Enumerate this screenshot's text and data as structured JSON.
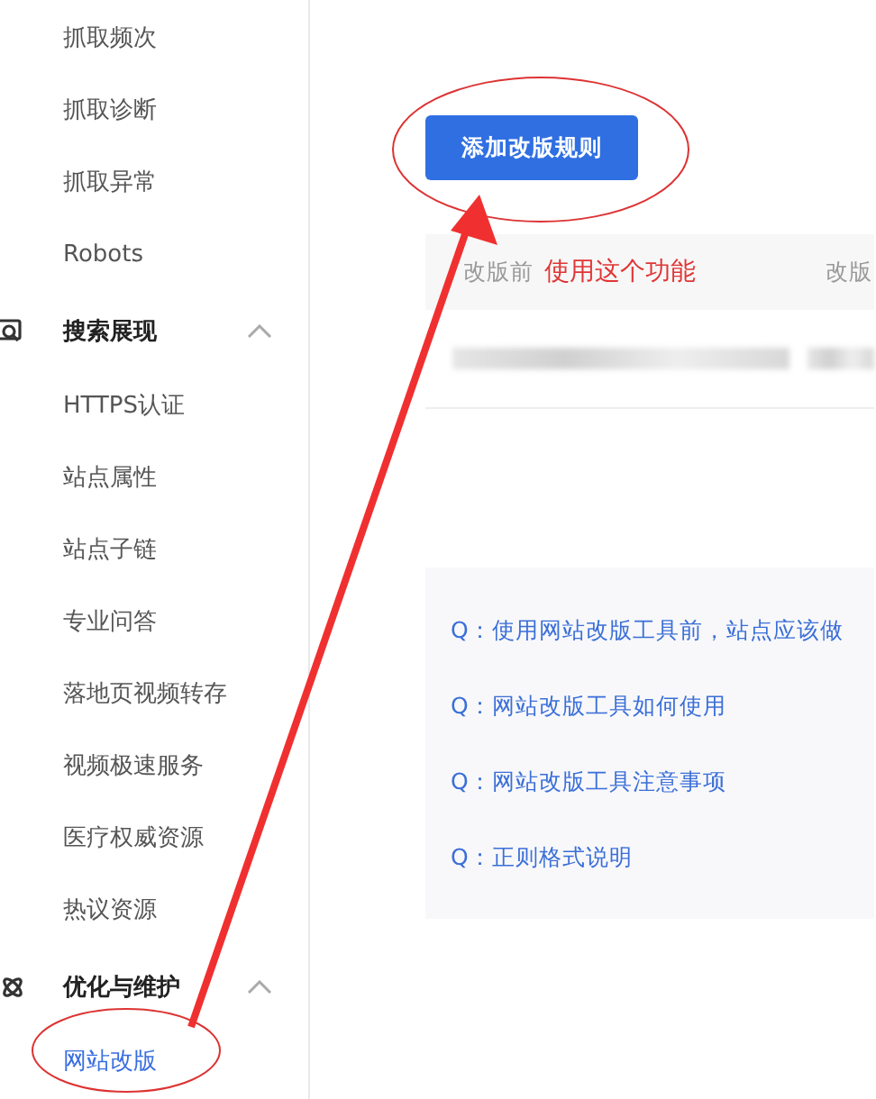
{
  "sidebar": {
    "items": [
      {
        "kind": "item",
        "label": "抓取频次",
        "selected": false
      },
      {
        "kind": "item",
        "label": "抓取诊断",
        "selected": false
      },
      {
        "kind": "item",
        "label": "抓取异常",
        "selected": false
      },
      {
        "kind": "item",
        "label": "Robots",
        "selected": false
      },
      {
        "kind": "header",
        "label": "搜索展现",
        "expanded": true
      },
      {
        "kind": "item",
        "label": "HTTPS认证",
        "selected": false
      },
      {
        "kind": "item",
        "label": "站点属性",
        "selected": false
      },
      {
        "kind": "item",
        "label": "站点子链",
        "selected": false
      },
      {
        "kind": "item",
        "label": "专业问答",
        "selected": false
      },
      {
        "kind": "item",
        "label": "落地页视频转存",
        "selected": false
      },
      {
        "kind": "item",
        "label": "视频极速服务",
        "selected": false
      },
      {
        "kind": "item",
        "label": "医疗权威资源",
        "selected": false
      },
      {
        "kind": "item",
        "label": "热议资源",
        "selected": false
      },
      {
        "kind": "header",
        "label": "优化与维护",
        "expanded": true
      },
      {
        "kind": "item",
        "label": "网站改版",
        "selected": true
      }
    ]
  },
  "main": {
    "add_button": "添加改版规则",
    "table": {
      "columns": [
        "改版前",
        "改版"
      ]
    },
    "annotation": "使用这个功能",
    "faq": [
      "Q：使用网站改版工具前，站点应该做",
      "Q：网站改版工具如何使用",
      "Q：网站改版工具注意事项",
      "Q：正则格式说明"
    ]
  }
}
